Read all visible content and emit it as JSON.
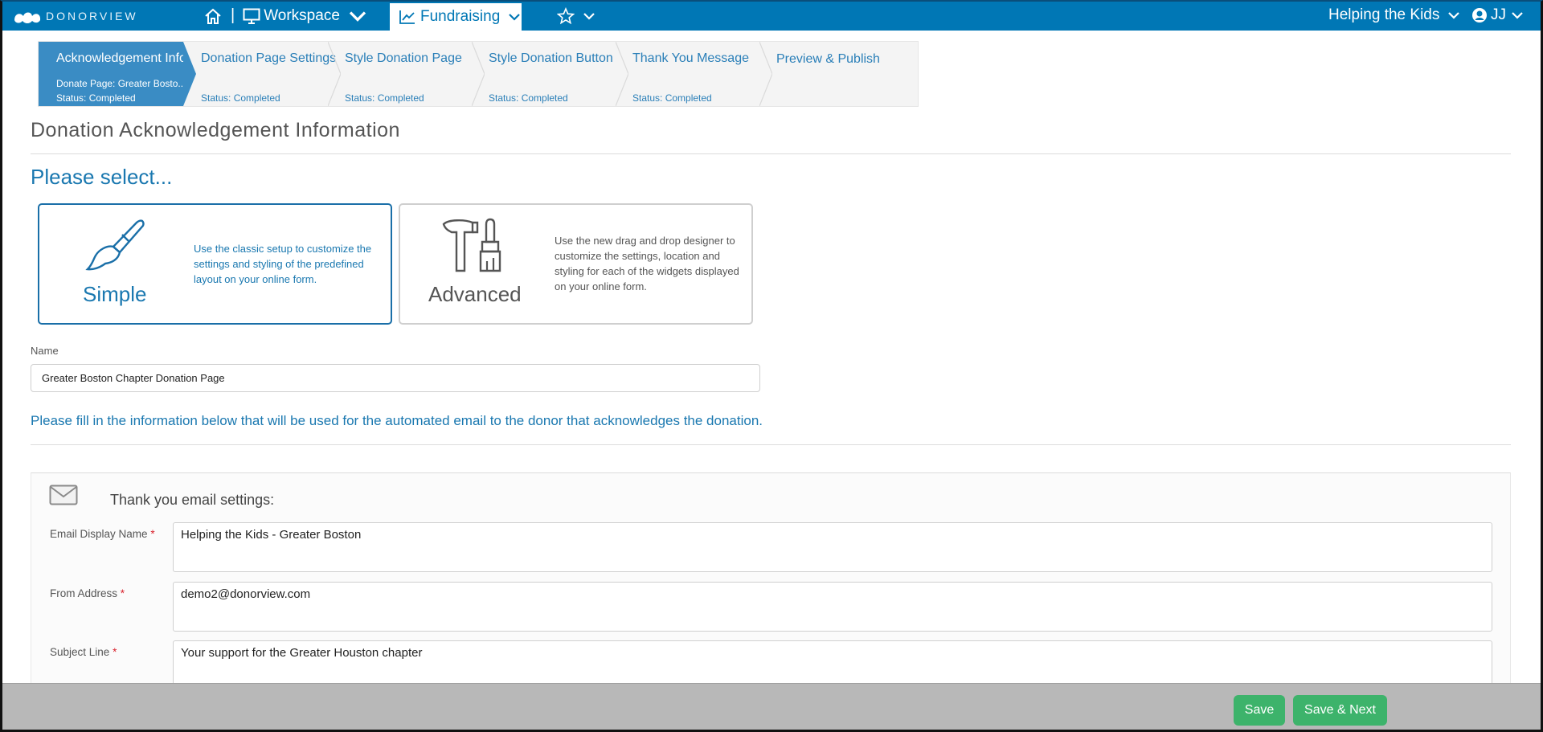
{
  "app": {
    "logo_text": "DONORVIEW"
  },
  "topnav": {
    "separator": "|",
    "workspace_label": "Workspace",
    "fundraising_label": "Fundraising",
    "organization": "Helping the Kids",
    "user_initials": "JJ",
    "colors": {
      "bar": "#0077b5",
      "active_tab_bg": "#ffffff"
    }
  },
  "wizard": {
    "steps": [
      {
        "title": "Acknowledgement Info",
        "sub1": "Donate Page: Greater Bosto...",
        "sub2": "Status: Completed",
        "active": true
      },
      {
        "title": "Donation Page Settings",
        "sub2": "Status: Completed",
        "active": false
      },
      {
        "title": "Style Donation Page",
        "sub2": "Status: Completed",
        "active": false
      },
      {
        "title": "Style Donation Button",
        "sub2": "Status: Completed",
        "active": false
      },
      {
        "title": "Thank You Message",
        "sub2": "Status: Completed",
        "active": false
      },
      {
        "title": "Preview & Publish",
        "active": false
      }
    ]
  },
  "page": {
    "title": "Donation Acknowledgement Information",
    "select_prompt": "Please select...",
    "options": {
      "simple": {
        "label": "Simple",
        "description": "Use the classic setup to customize the settings and styling of the predefined layout on your online form.",
        "selected": true
      },
      "advanced": {
        "label": "Advanced",
        "description": "Use the new drag and drop designer to customize the settings, location and styling for each of the widgets displayed on your online form.",
        "selected": false
      }
    },
    "name_label": "Name",
    "name_value": "Greater Boston Chapter Donation Page",
    "info_text": "Please fill in the information below that will be used for the automated email to the donor that acknowledges the donation."
  },
  "email_settings": {
    "title": "Thank you email settings:",
    "required_marker": "*",
    "fields": [
      {
        "label": "Email Display Name",
        "value": "Helping the Kids - Greater Boston"
      },
      {
        "label": "From Address",
        "value": "demo2@donorview.com"
      },
      {
        "label": "Subject Line",
        "value": "Your support for the Greater Houston chapter"
      }
    ]
  },
  "footer": {
    "save_label": "Save",
    "save_next_label": "Save & Next",
    "button_color": "#3db36b"
  }
}
